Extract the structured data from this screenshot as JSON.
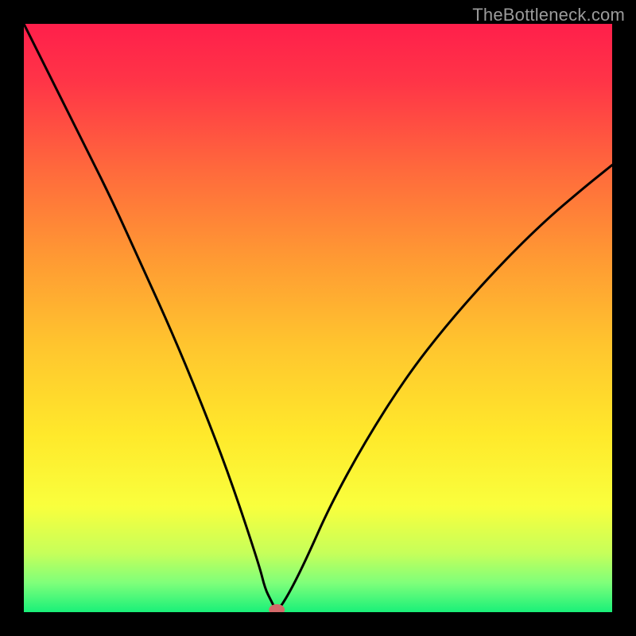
{
  "attribution": "TheBottleneck.com",
  "chart_data": {
    "type": "line",
    "title": "",
    "xlabel": "",
    "ylabel": "",
    "xlim": [
      0,
      1
    ],
    "ylim": [
      0,
      1
    ],
    "grid": false,
    "legend": false,
    "min_point": {
      "x": 0.43,
      "y": 0.0
    },
    "series": [
      {
        "name": "bottleneck-curve",
        "x": [
          0.0,
          0.05,
          0.1,
          0.15,
          0.2,
          0.25,
          0.3,
          0.35,
          0.4,
          0.41,
          0.42,
          0.43,
          0.45,
          0.48,
          0.52,
          0.58,
          0.65,
          0.72,
          0.8,
          0.88,
          0.95,
          1.0
        ],
        "y": [
          1.0,
          0.9,
          0.8,
          0.7,
          0.59,
          0.48,
          0.36,
          0.23,
          0.08,
          0.04,
          0.02,
          0.0,
          0.03,
          0.09,
          0.18,
          0.29,
          0.4,
          0.49,
          0.58,
          0.66,
          0.72,
          0.76
        ]
      }
    ],
    "gradient_stops": [
      {
        "offset": 0.0,
        "color": "#ff1f4b"
      },
      {
        "offset": 0.1,
        "color": "#ff3547"
      },
      {
        "offset": 0.25,
        "color": "#ff6a3c"
      },
      {
        "offset": 0.4,
        "color": "#ff9a33"
      },
      {
        "offset": 0.55,
        "color": "#ffc62e"
      },
      {
        "offset": 0.7,
        "color": "#ffe92b"
      },
      {
        "offset": 0.82,
        "color": "#f9ff3d"
      },
      {
        "offset": 0.9,
        "color": "#c6ff5a"
      },
      {
        "offset": 0.95,
        "color": "#7fff7a"
      },
      {
        "offset": 1.0,
        "color": "#19f079"
      }
    ],
    "marker": {
      "color": "#d46a6a",
      "rx": 10,
      "ry": 7
    }
  }
}
